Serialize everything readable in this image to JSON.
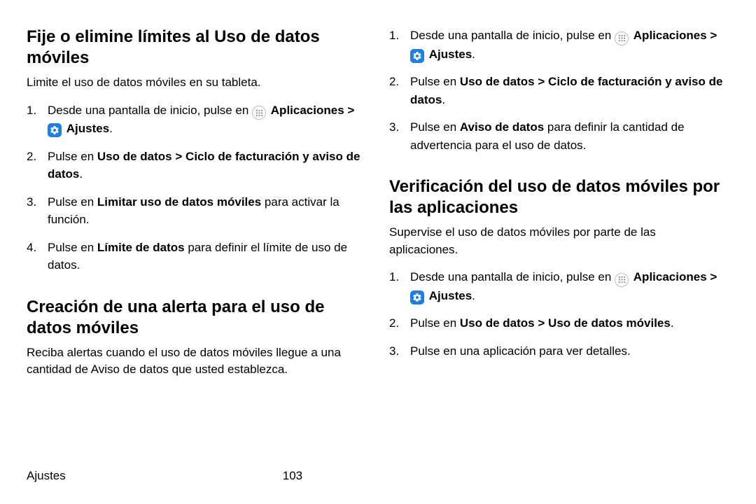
{
  "footer": {
    "section": "Ajustes",
    "page": "103"
  },
  "ui": {
    "chev": ">",
    "period": "."
  },
  "sec1": {
    "heading": "Fije o elimine límites al Uso de datos móviles",
    "intro": "Limite el uso de datos móviles en su tableta.",
    "step1a": "Desde una pantalla de inicio, pulse en ",
    "apps": "Aplicaciones",
    "ajustes": "Ajustes",
    "step2a": "Pulse en ",
    "step2b": "Uso de datos",
    "step2c": "Ciclo de facturación y aviso de datos",
    "step3a": "Pulse en ",
    "step3b": "Limitar uso de datos móviles",
    "step3c": " para activar la función.",
    "step4a": "Pulse en ",
    "step4b": "Límite de datos",
    "step4c": " para definir el límite de uso de datos."
  },
  "sec2": {
    "heading": "Creación de una alerta para el uso de datos móviles",
    "intro": "Reciba alertas cuando el uso de datos móviles llegue a una cantidad de Aviso de datos que usted establezca."
  },
  "sec3": {
    "step1a": "Desde una pantalla de inicio, pulse en ",
    "apps": "Aplicaciones",
    "ajustes": "Ajustes",
    "step2a": "Pulse en ",
    "step2b": "Uso de datos",
    "step2c": "Ciclo de facturación y aviso de datos",
    "step3a": "Pulse en ",
    "step3b": "Aviso de datos",
    "step3c": " para definir la cantidad de advertencia para el uso de datos."
  },
  "sec4": {
    "heading": "Verificación del uso de datos móviles por las aplicaciones",
    "intro": "Supervise el uso de datos móviles por parte de las aplicaciones.",
    "step1a": "Desde una pantalla de inicio, pulse en ",
    "apps": "Aplicaciones",
    "ajustes": "Ajustes",
    "step2a": "Pulse en ",
    "step2b": "Uso de datos",
    "step2c": "Uso de datos móviles",
    "step3": "Pulse en una aplicación para ver detalles."
  }
}
